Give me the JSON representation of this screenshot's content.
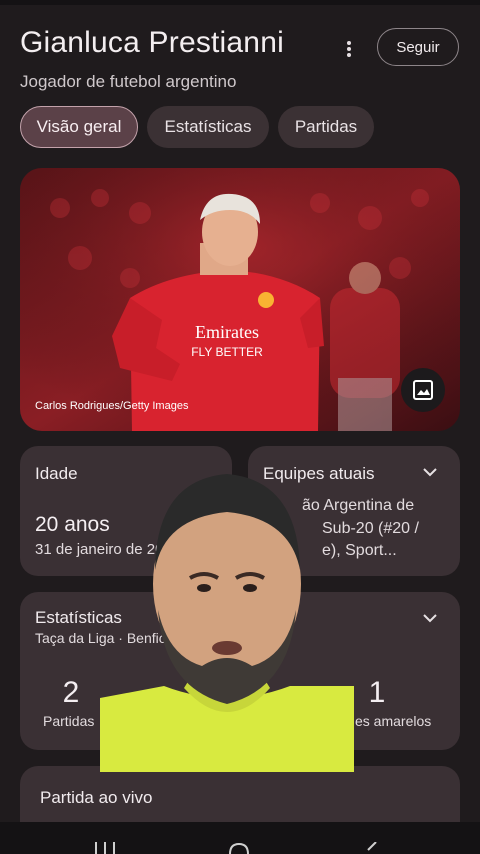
{
  "header": {
    "title": "Gianluca Prestianni",
    "subtitle": "Jogador de futebol argentino",
    "follow_label": "Seguir",
    "more_icon": "more-vert-icon"
  },
  "tabs": [
    {
      "label": "Visão geral",
      "active": true
    },
    {
      "label": "Estatísticas",
      "active": false
    },
    {
      "label": "Partidas",
      "active": false
    }
  ],
  "hero": {
    "credit": "Carlos Rodrigues/Getty Images",
    "image_icon": "image-icon",
    "jersey_sponsor": "Emirates",
    "jersey_tagline": "FLY BETTER"
  },
  "age_card": {
    "label": "Idade",
    "value": "20 anos",
    "birthdate": "31 de janeiro de 20"
  },
  "teams_card": {
    "label": "Equipes atuais",
    "line1": "ão Argentina de",
    "line2": "Sub-20 (#20 /",
    "line3": "e), Sport..."
  },
  "stats_card": {
    "label": "Estatísticas",
    "competition": "Taça da Liga · Benfica",
    "stat1_value": "2",
    "stat1_label": "Partidas",
    "stat2_value": "1",
    "stat2_label": "es amarelos"
  },
  "live_card": {
    "label": "Partida ao vivo"
  },
  "colors": {
    "background": "#1f1b1d",
    "card": "#3a3034",
    "chip": "#3b3134",
    "chip_active": "#5b4148",
    "jersey_red": "#d8232f"
  }
}
